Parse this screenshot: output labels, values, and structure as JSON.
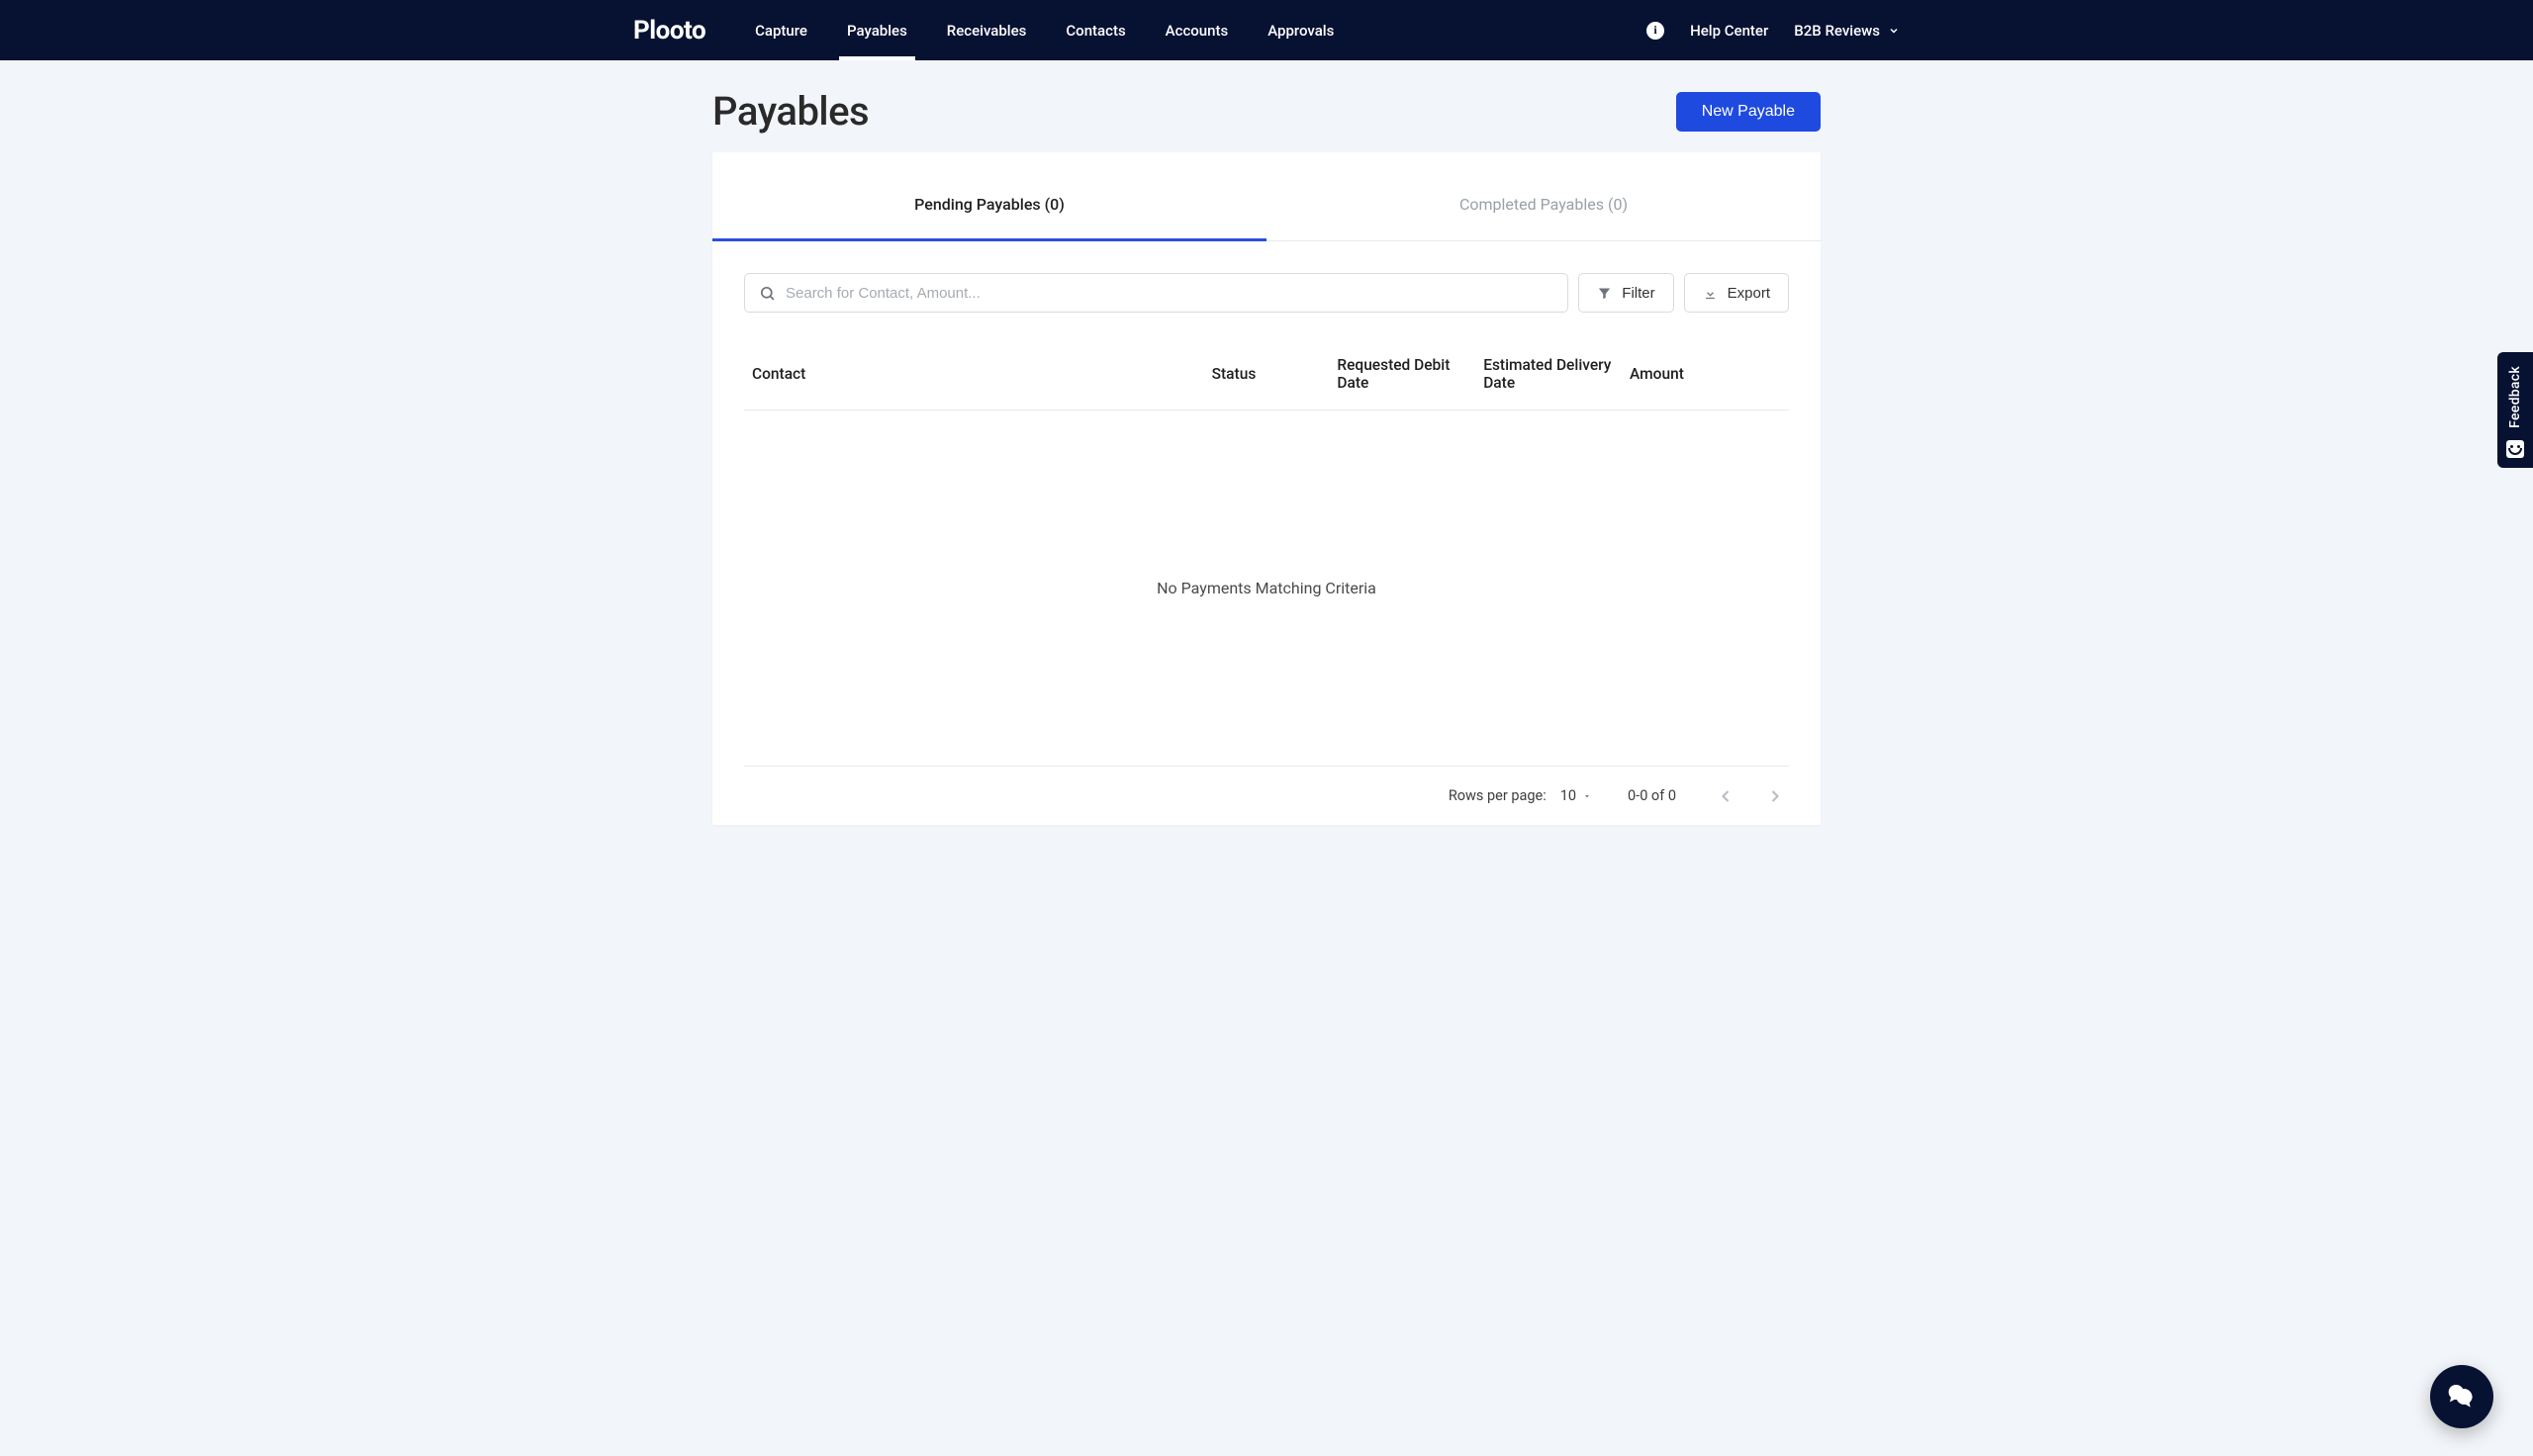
{
  "brand": "Plooto",
  "nav": {
    "items": [
      "Capture",
      "Payables",
      "Receivables",
      "Contacts",
      "Accounts",
      "Approvals"
    ],
    "active_index": 1,
    "help_label": "Help Center",
    "b2b_label": "B2B Reviews"
  },
  "page": {
    "title": "Payables",
    "primary_action": "New Payable"
  },
  "tabs": {
    "pending": {
      "label": "Pending Payables",
      "count": 0
    },
    "completed": {
      "label": "Completed Payables",
      "count": 0
    },
    "active": "pending"
  },
  "toolbar": {
    "search_placeholder": "Search for Contact, Amount...",
    "filter_label": "Filter",
    "export_label": "Export"
  },
  "table": {
    "columns": [
      "Contact",
      "Status",
      "Requested Debit Date",
      "Estimated Delivery Date",
      "Amount"
    ],
    "empty_message": "No Payments Matching Criteria"
  },
  "pager": {
    "rows_label": "Rows per page:",
    "rows_value": "10",
    "range": "0-0 of 0"
  },
  "feedback": {
    "label": "Feedback"
  }
}
